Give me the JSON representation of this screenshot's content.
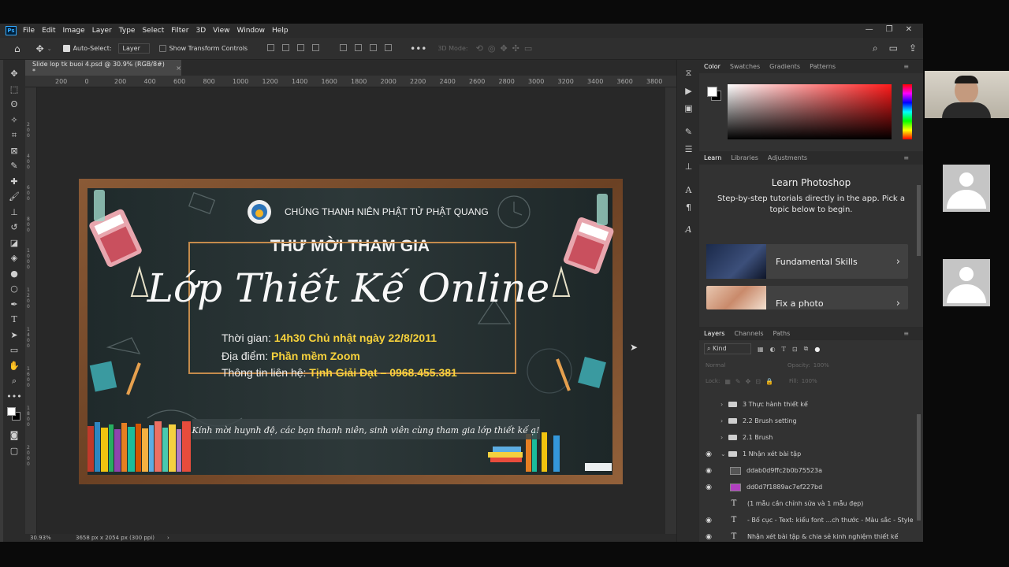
{
  "menubar": {
    "logo": "Ps",
    "items": [
      "File",
      "Edit",
      "Image",
      "Layer",
      "Type",
      "Select",
      "Filter",
      "3D",
      "View",
      "Window",
      "Help"
    ]
  },
  "options": {
    "auto_select_label": "Auto-Select:",
    "auto_select_target": "Layer",
    "transform_label": "Show Transform Controls",
    "mode_label": "3D Mode:"
  },
  "document": {
    "tab_title": "Slide lop tk buoi 4.psd @ 30.9% (RGB/8#) *",
    "ruler_ticks": [
      "200",
      "0",
      "200",
      "400",
      "600",
      "800",
      "1000",
      "1200",
      "1400",
      "1600",
      "1800",
      "2000",
      "2200",
      "2400",
      "2600",
      "2800",
      "3000",
      "3200",
      "3400",
      "3600",
      "3800"
    ],
    "zoom": "30.93%",
    "dimensions": "3658 px x 2054 px (300 ppi)"
  },
  "canvas_art": {
    "org": "CHÚNG THANH NIÊN PHẬT TỬ PHẬT QUANG",
    "invite": "THƯ MỜI THAM GIA",
    "headline": "Lớp Thiết Kế Online",
    "time_label": "Thời gian: ",
    "time_value": "14h30 Chủ nhật ngày 22/8/2011",
    "place_label": "Địa điểm: ",
    "place_value": "Phần mềm Zoom",
    "contact_label": "Thông tin liên hệ: ",
    "contact_value": "Tịnh Giải Đạt – 0968.455.381",
    "banner": "Kính mời huynh đệ, các bạn thanh niên, sinh viên cùng tham gia lớp thiết kế ạ!"
  },
  "color_panel": {
    "tabs": [
      "Color",
      "Swatches",
      "Gradients",
      "Patterns"
    ],
    "colors": {
      "hue": "#ff1a1a",
      "fg": "#ffffff",
      "bg": "#000000"
    }
  },
  "learn_panel": {
    "tabs": [
      "Learn",
      "Libraries",
      "Adjustments"
    ],
    "title": "Learn Photoshop",
    "subtitle": "Step-by-step tutorials directly in the app. Pick a topic below to begin.",
    "cards": [
      "Fundamental Skills",
      "Fix a photo"
    ]
  },
  "layers_panel": {
    "tabs": [
      "Layers",
      "Channels",
      "Paths"
    ],
    "kind_label": "Kind",
    "blend_mode": "Normal",
    "opacity_label": "Opacity:",
    "opacity_value": "100%",
    "lock_label": "Lock:",
    "fill_label": "Fill:",
    "fill_value": "100%",
    "layers": [
      {
        "name": "3 Thực hành thiết kế"
      },
      {
        "name": "2.2 Brush setting"
      },
      {
        "name": "2.1 Brush"
      },
      {
        "name": "1 Nhận xét bài tập"
      },
      {
        "name": "ddab0d9ffc2b0b75523a"
      },
      {
        "name": "dd0d7f1889ac7ef227bd"
      },
      {
        "name": "(1 mẫu cần chỉnh sửa và 1 mẫu đẹp)"
      },
      {
        "name": "- Bố cục - Text: kiểu font ...ch thước - Màu sắc - Style"
      },
      {
        "name": "Nhận xét bài tập  & chia sẻ kinh nghiệm thiết kế"
      }
    ]
  }
}
